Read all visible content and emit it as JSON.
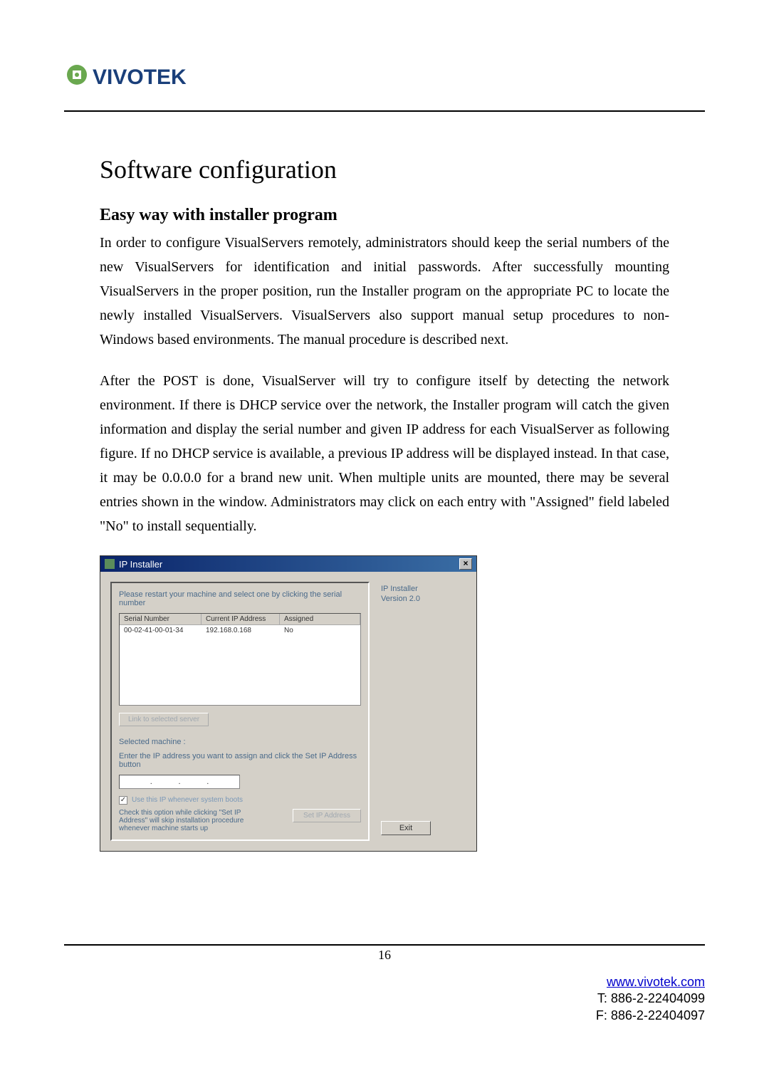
{
  "logo": {
    "text": "VIVOTEK"
  },
  "title": "Software configuration",
  "subtitle": "Easy way with installer program",
  "para1": "In order to configure VisualServers remotely, administrators should keep the serial numbers of the new VisualServers for identification and initial passwords. After successfully mounting VisualServers in the proper position, run the Installer program on the appropriate PC to locate the newly installed VisualServers. VisualServers also support manual setup procedures to non-Windows based environments. The manual procedure is described next.",
  "para2": "After the POST is done, VisualServer will try to configure itself by detecting the network environment. If there is DHCP service over the network, the Installer program will catch the given information and display the serial number and given IP address for each VisualServer as following figure. If no DHCP service is available, a previous IP address will be displayed instead. In that case, it may be 0.0.0.0 for a brand new unit. When multiple units are mounted, there may be several entries shown in the window. Administrators may click on each entry with \"Assigned\" field labeled \"No\" to install sequentially.",
  "installer": {
    "title": "IP Installer",
    "instruction": "Please restart your machine and select one by clicking the serial number",
    "columns": {
      "serial": "Serial Number",
      "ip": "Current IP Address",
      "assigned": "Assigned"
    },
    "rows": [
      {
        "serial": "00-02-41-00-01-34",
        "ip": "192.168.0.168",
        "assigned": "No"
      }
    ],
    "link_button": "Link to selected server",
    "selected_label": "Selected machine :",
    "enter_ip": "Enter the IP address you want to assign and click the Set IP Address button",
    "ip_value": "",
    "checkbox_label": "Use this IP whenever system boots",
    "help_text": "Check this option while clicking \"Set IP Address\" will skip installation procedure whenever machine starts up",
    "set_ip_button": "Set IP Address",
    "product": "IP Installer",
    "version": "Version 2.0",
    "exit_button": "Exit"
  },
  "page_number": "16",
  "footer": {
    "website": "www.vivotek.com",
    "tel": "T: 886-2-22404099",
    "fax": "F: 886-2-22404097"
  }
}
